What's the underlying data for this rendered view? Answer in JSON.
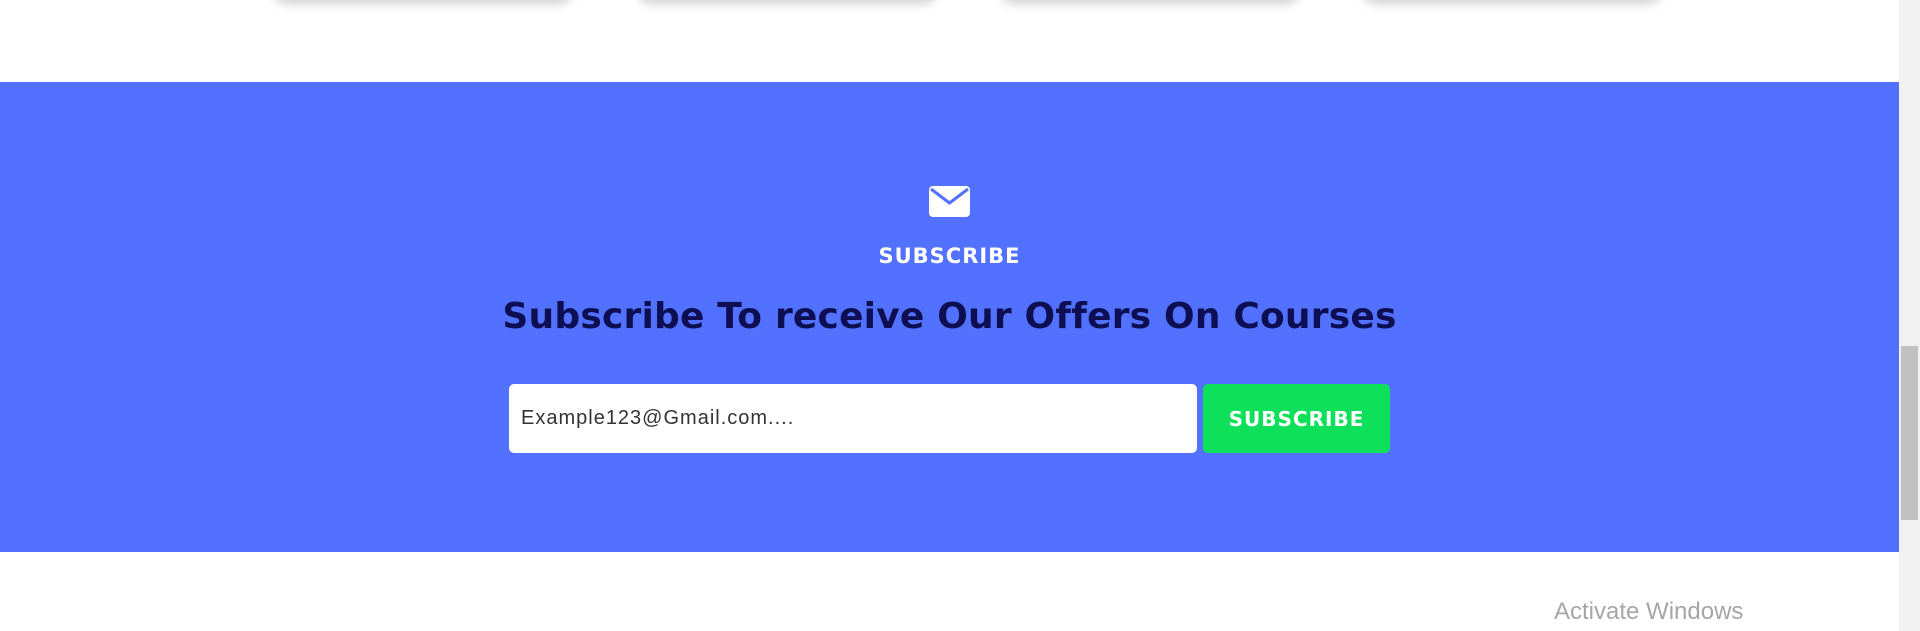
{
  "subscribe_section": {
    "eyebrow": "SUBSCRIBE",
    "headline": "Subscribe To receive Our Offers On Courses",
    "email_placeholder": "Example123@Gmail.com....",
    "button_label": "SUBSCRIBE",
    "icon": "envelope-icon"
  },
  "watermark": {
    "text": "Activate Windows"
  },
  "colors": {
    "band_background": "#5271ff",
    "headline": "#0d0f52",
    "button": "#0ee05a",
    "text_light": "#ffffff"
  }
}
